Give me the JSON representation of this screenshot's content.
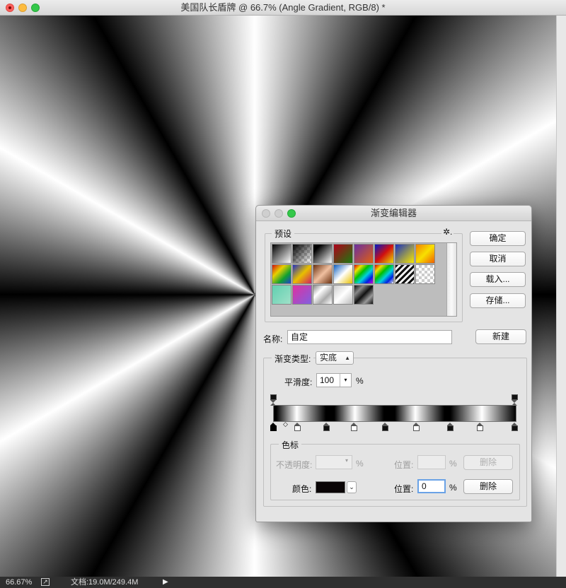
{
  "window": {
    "title": "美国队长盾牌 @ 66.7% (Angle Gradient, RGB/8) *"
  },
  "statusbar": {
    "zoom": "66.67%",
    "doc_info": "文档:19.0M/249.4M",
    "arrow": "▶"
  },
  "dialog": {
    "title": "渐变编辑器",
    "presets_label": "预设",
    "settings_icon": "✲.",
    "buttons": {
      "ok": "确定",
      "cancel": "取消",
      "load": "载入...",
      "save": "存储...",
      "new": "新建"
    },
    "name_label": "名称:",
    "name_value": "自定",
    "gradient_type_label": "渐变类型:",
    "gradient_type_value": "实底",
    "smoothness_label": "平滑度:",
    "smoothness_value": "100",
    "smoothness_unit": "%",
    "stops_group_label": "色标",
    "opacity_label": "不透明度:",
    "opacity_value": "",
    "opacity_unit": "%",
    "opacity_position_label": "位置:",
    "opacity_position_value": "",
    "opacity_position_unit": "%",
    "opacity_delete": "删除",
    "color_label": "颜色:",
    "color_value": "#0a0506",
    "color_position_label": "位置:",
    "color_position_value": "0",
    "color_position_unit": "%",
    "color_delete": "删除"
  }
}
